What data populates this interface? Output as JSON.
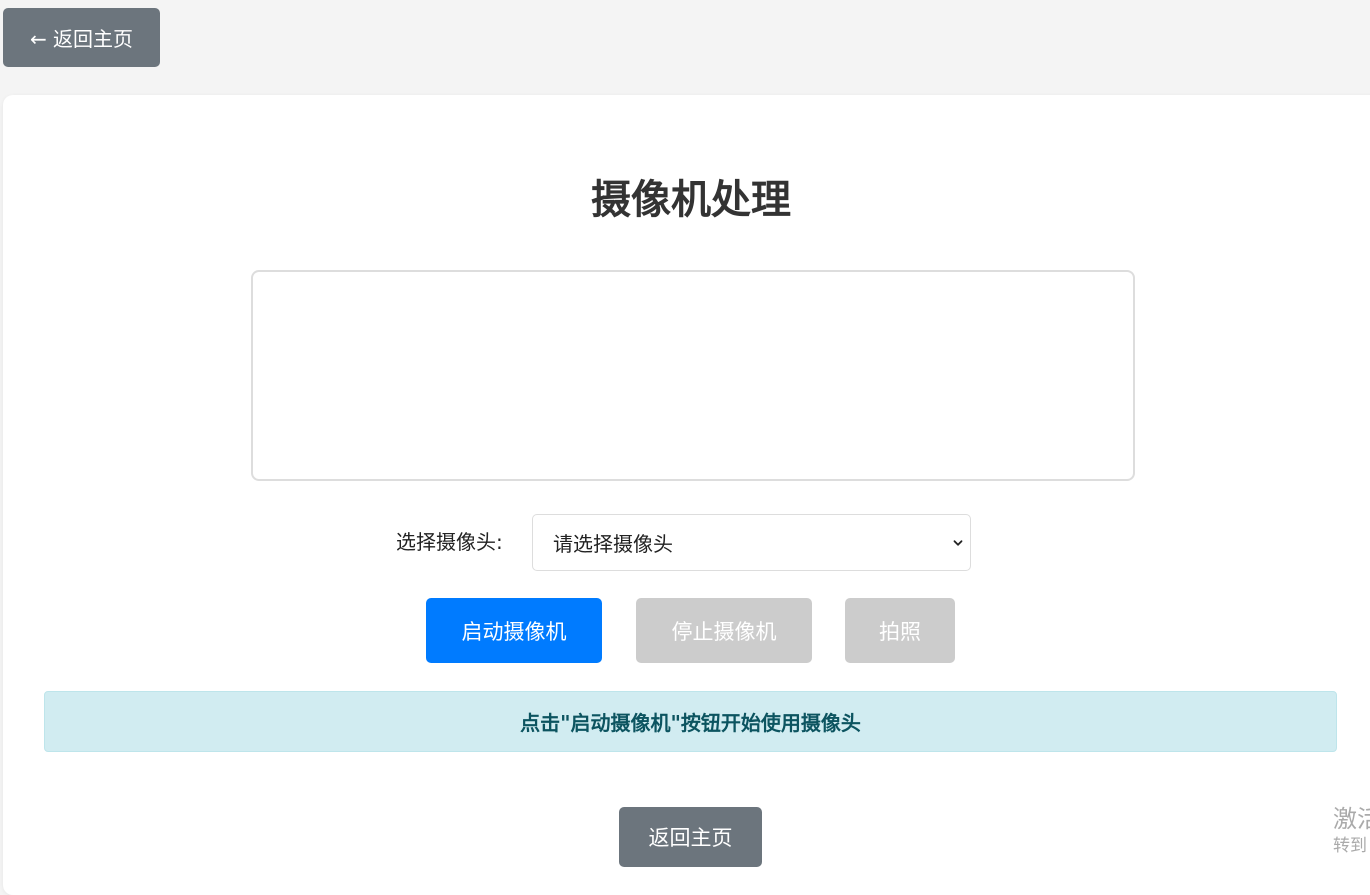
{
  "top_nav": {
    "back_label": "← 返回主页"
  },
  "page": {
    "title": "摄像机处理"
  },
  "camera_select": {
    "label": "选择摄像头:",
    "selected": "请选择摄像头"
  },
  "controls": {
    "start_label": "启动摄像机",
    "stop_label": "停止摄像机",
    "photo_label": "拍照",
    "start_color": "#007bff",
    "disabled_color": "#cccccc"
  },
  "status": {
    "message": "点击\"启动摄像机\"按钮开始使用摄像头"
  },
  "footer": {
    "back_label": "返回主页"
  },
  "watermark": {
    "line1": "激活",
    "line2": "转到"
  }
}
